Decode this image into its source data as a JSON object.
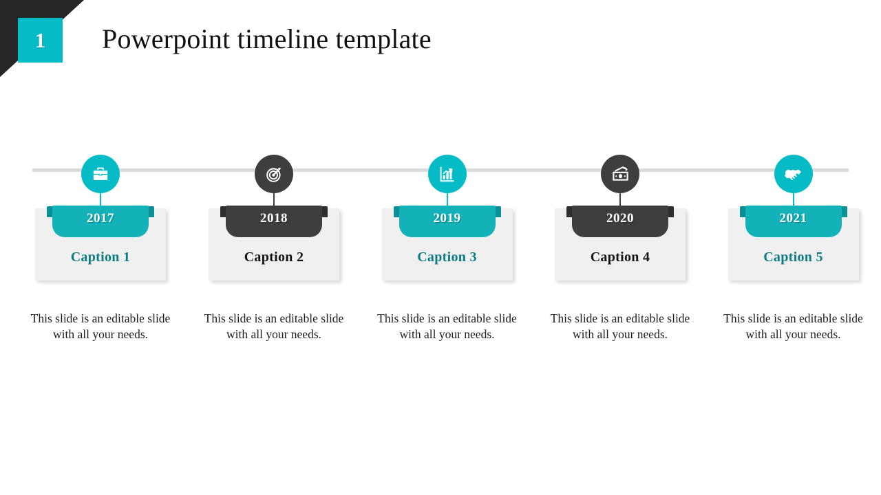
{
  "slide": {
    "number": "1",
    "title": "Powerpoint timeline template"
  },
  "colors": {
    "teal": "#05bcc6",
    "teal_ribbon": "#12b2b8",
    "teal_tab": "#0b8e96",
    "teal_caption": "#0d7b84",
    "dark": "#3e3e3e",
    "dark_corner": "#262626",
    "dark_tab": "#2d2d2d",
    "card": "#f0f0f0",
    "axis": "#dcdcdc",
    "text": "#1d1d1d"
  },
  "timeline": {
    "axis_visible": true,
    "items": [
      {
        "year": "2017",
        "caption": "Caption 1",
        "body": "This slide is an editable slide with all your needs.",
        "icon": "briefcase-icon",
        "theme": "teal"
      },
      {
        "year": "2018",
        "caption": "Caption 2",
        "body": "This slide is an editable slide with all your needs.",
        "icon": "target-icon",
        "theme": "dark"
      },
      {
        "year": "2019",
        "caption": "Caption 3",
        "body": "This slide is an editable slide with all your needs.",
        "icon": "bar-chart-growth-icon",
        "theme": "teal"
      },
      {
        "year": "2020",
        "caption": "Caption 4",
        "body": "This slide is an editable slide with all your needs.",
        "icon": "money-banknotes-icon",
        "theme": "dark"
      },
      {
        "year": "2021",
        "caption": "Caption 5",
        "body": "This slide is an editable slide with all your needs.",
        "icon": "handshake-icon",
        "theme": "teal"
      }
    ]
  }
}
